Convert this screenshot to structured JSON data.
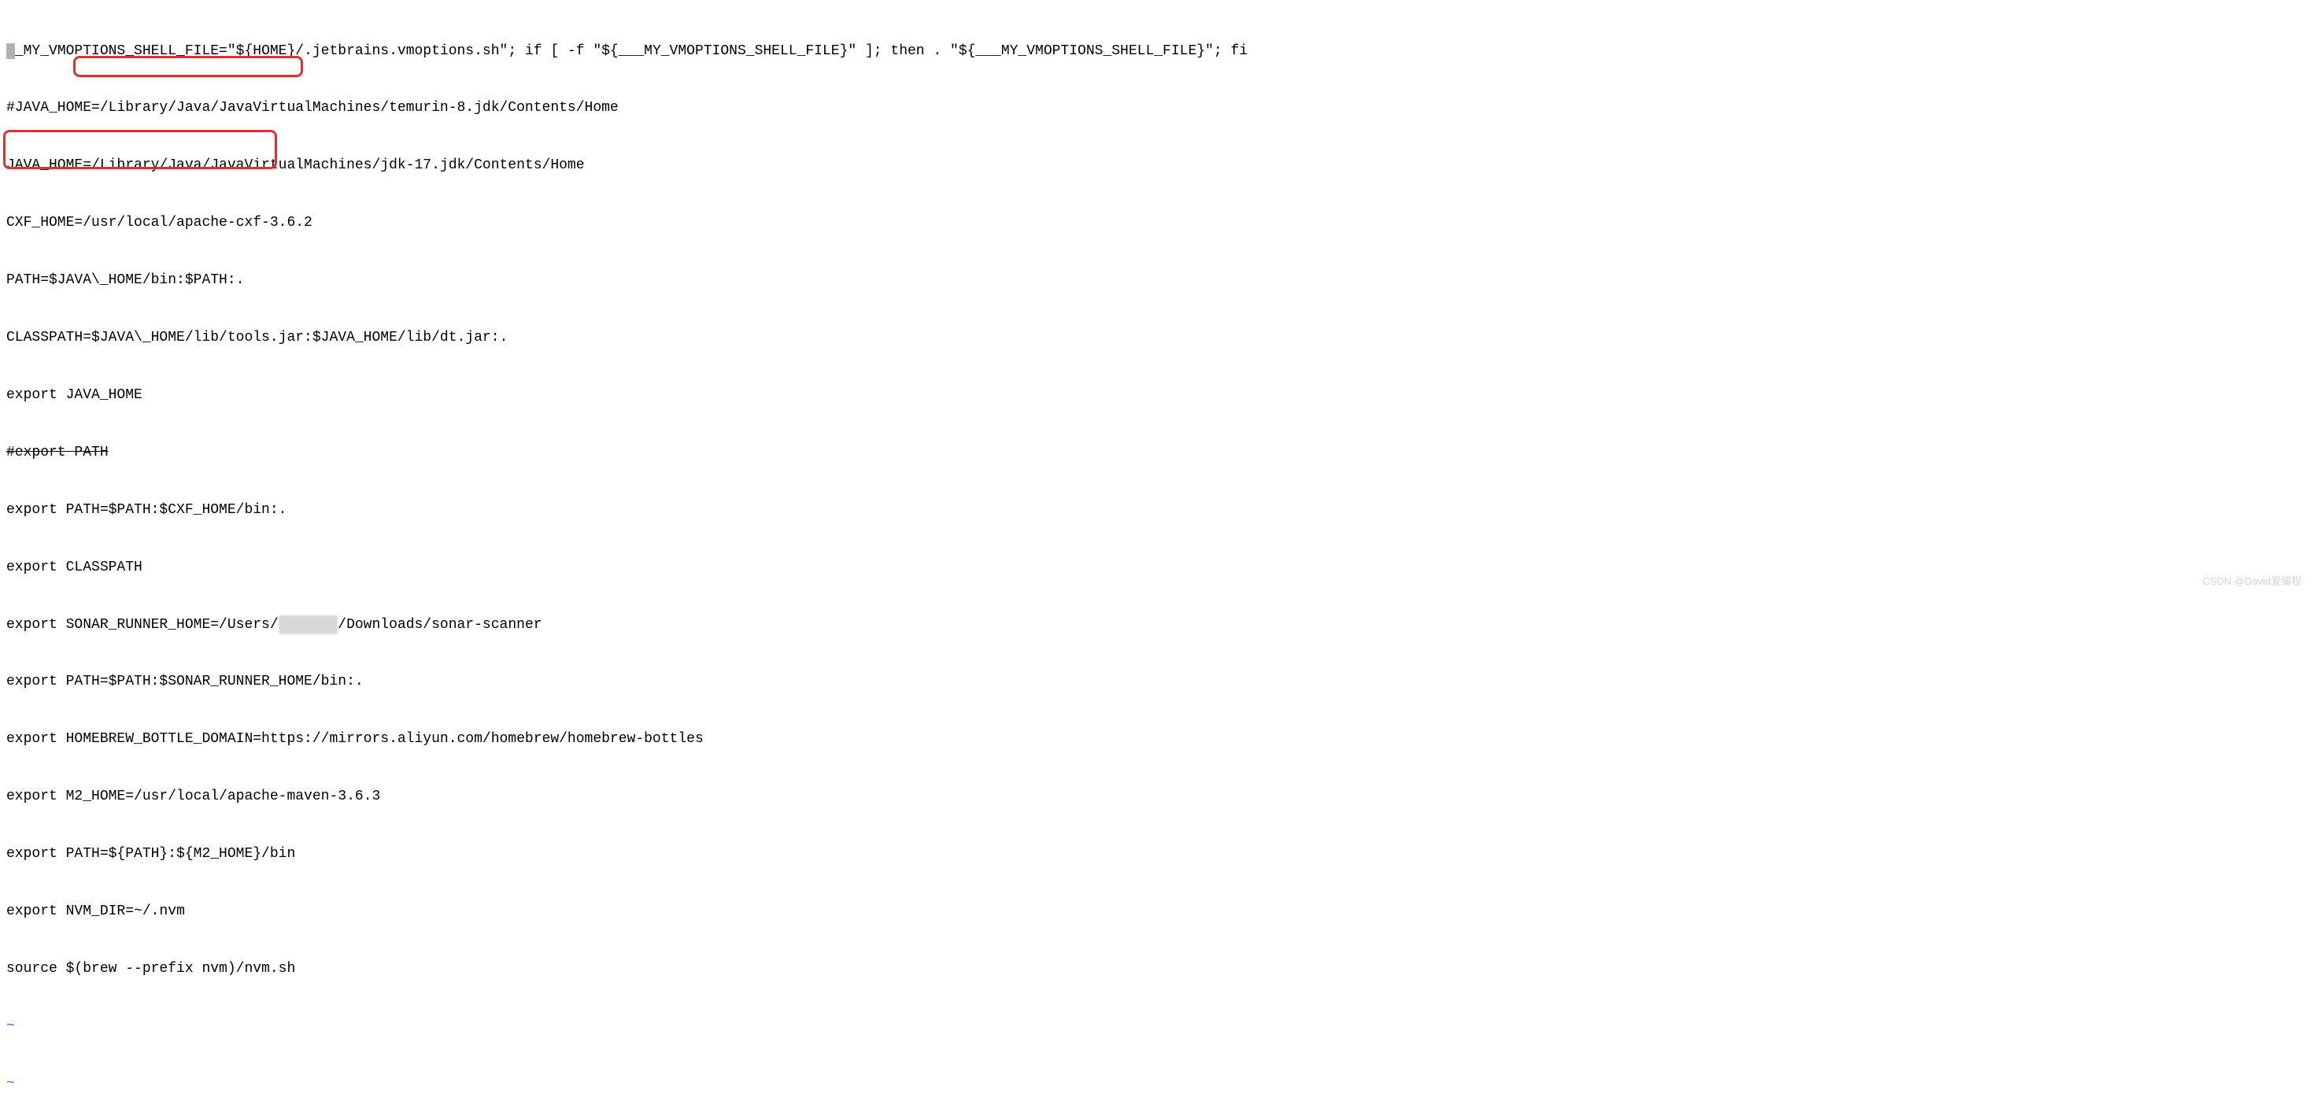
{
  "lines": {
    "l1_prefix": "_",
    "l1_rest": "_MY_VMOPTIONS_SHELL_FILE=\"${HOME}/.jetbrains.vmoptions.sh\"; if [ -f \"${___MY_VMOPTIONS_SHELL_FILE}\" ]; then . \"${___MY_VMOPTIONS_SHELL_FILE}\"; fi",
    "l2": "#JAVA_HOME=/Library/Java/JavaVirtualMachines/temurin-8.jdk/Contents/Home",
    "l3": "JAVA_HOME=/Library/Java/JavaVirtualMachines/jdk-17.jdk/Contents/Home",
    "l4": "CXF_HOME=/usr/local/apache-cxf-3.6.2",
    "l5": "PATH=$JAVA\\_HOME/bin:$PATH:.",
    "l6": "CLASSPATH=$JAVA\\_HOME/lib/tools.jar:$JAVA_HOME/lib/dt.jar:.",
    "l7": "export JAVA_HOME",
    "l8": "#export PATH",
    "l9": "export PATH=$PATH:$CXF_HOME/bin:.",
    "l10": "export CLASSPATH",
    "l11_a": "export SONAR_RUNNER_HOME=/Users/",
    "l11_redacted": "xxxxxxx",
    "l11_b": "/Downloads/sonar-scanner",
    "l12": "export PATH=$PATH:$SONAR_RUNNER_HOME/bin:.",
    "l13": "export HOMEBREW_BOTTLE_DOMAIN=https://mirrors.aliyun.com/homebrew/homebrew-bottles",
    "l14": "export M2_HOME=/usr/local/apache-maven-3.6.3",
    "l15": "export PATH=${PATH}:${M2_HOME}/bin",
    "l16": "export NVM_DIR=~/.nvm",
    "l17": "source $(brew --prefix nvm)/nvm.sh",
    "tilde": "~"
  },
  "watermark": "CSDN @David爱编程"
}
